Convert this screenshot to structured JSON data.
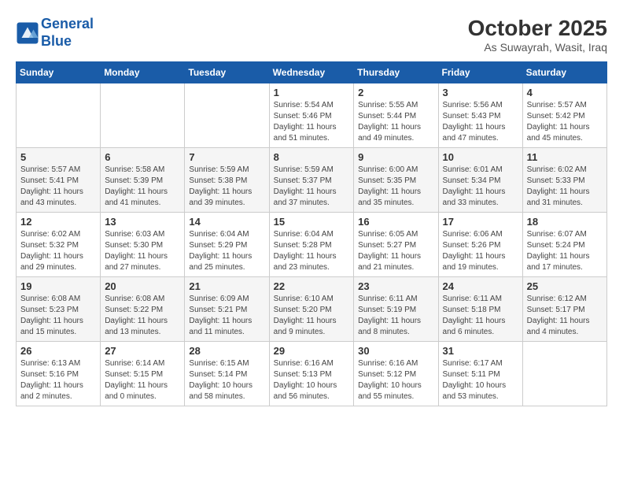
{
  "logo": {
    "line1": "General",
    "line2": "Blue"
  },
  "title": "October 2025",
  "location": "As Suwayrah, Wasit, Iraq",
  "days_of_week": [
    "Sunday",
    "Monday",
    "Tuesday",
    "Wednesday",
    "Thursday",
    "Friday",
    "Saturday"
  ],
  "weeks": [
    [
      {
        "day": "",
        "info": ""
      },
      {
        "day": "",
        "info": ""
      },
      {
        "day": "",
        "info": ""
      },
      {
        "day": "1",
        "info": "Sunrise: 5:54 AM\nSunset: 5:46 PM\nDaylight: 11 hours\nand 51 minutes."
      },
      {
        "day": "2",
        "info": "Sunrise: 5:55 AM\nSunset: 5:44 PM\nDaylight: 11 hours\nand 49 minutes."
      },
      {
        "day": "3",
        "info": "Sunrise: 5:56 AM\nSunset: 5:43 PM\nDaylight: 11 hours\nand 47 minutes."
      },
      {
        "day": "4",
        "info": "Sunrise: 5:57 AM\nSunset: 5:42 PM\nDaylight: 11 hours\nand 45 minutes."
      }
    ],
    [
      {
        "day": "5",
        "info": "Sunrise: 5:57 AM\nSunset: 5:41 PM\nDaylight: 11 hours\nand 43 minutes."
      },
      {
        "day": "6",
        "info": "Sunrise: 5:58 AM\nSunset: 5:39 PM\nDaylight: 11 hours\nand 41 minutes."
      },
      {
        "day": "7",
        "info": "Sunrise: 5:59 AM\nSunset: 5:38 PM\nDaylight: 11 hours\nand 39 minutes."
      },
      {
        "day": "8",
        "info": "Sunrise: 5:59 AM\nSunset: 5:37 PM\nDaylight: 11 hours\nand 37 minutes."
      },
      {
        "day": "9",
        "info": "Sunrise: 6:00 AM\nSunset: 5:35 PM\nDaylight: 11 hours\nand 35 minutes."
      },
      {
        "day": "10",
        "info": "Sunrise: 6:01 AM\nSunset: 5:34 PM\nDaylight: 11 hours\nand 33 minutes."
      },
      {
        "day": "11",
        "info": "Sunrise: 6:02 AM\nSunset: 5:33 PM\nDaylight: 11 hours\nand 31 minutes."
      }
    ],
    [
      {
        "day": "12",
        "info": "Sunrise: 6:02 AM\nSunset: 5:32 PM\nDaylight: 11 hours\nand 29 minutes."
      },
      {
        "day": "13",
        "info": "Sunrise: 6:03 AM\nSunset: 5:30 PM\nDaylight: 11 hours\nand 27 minutes."
      },
      {
        "day": "14",
        "info": "Sunrise: 6:04 AM\nSunset: 5:29 PM\nDaylight: 11 hours\nand 25 minutes."
      },
      {
        "day": "15",
        "info": "Sunrise: 6:04 AM\nSunset: 5:28 PM\nDaylight: 11 hours\nand 23 minutes."
      },
      {
        "day": "16",
        "info": "Sunrise: 6:05 AM\nSunset: 5:27 PM\nDaylight: 11 hours\nand 21 minutes."
      },
      {
        "day": "17",
        "info": "Sunrise: 6:06 AM\nSunset: 5:26 PM\nDaylight: 11 hours\nand 19 minutes."
      },
      {
        "day": "18",
        "info": "Sunrise: 6:07 AM\nSunset: 5:24 PM\nDaylight: 11 hours\nand 17 minutes."
      }
    ],
    [
      {
        "day": "19",
        "info": "Sunrise: 6:08 AM\nSunset: 5:23 PM\nDaylight: 11 hours\nand 15 minutes."
      },
      {
        "day": "20",
        "info": "Sunrise: 6:08 AM\nSunset: 5:22 PM\nDaylight: 11 hours\nand 13 minutes."
      },
      {
        "day": "21",
        "info": "Sunrise: 6:09 AM\nSunset: 5:21 PM\nDaylight: 11 hours\nand 11 minutes."
      },
      {
        "day": "22",
        "info": "Sunrise: 6:10 AM\nSunset: 5:20 PM\nDaylight: 11 hours\nand 9 minutes."
      },
      {
        "day": "23",
        "info": "Sunrise: 6:11 AM\nSunset: 5:19 PM\nDaylight: 11 hours\nand 8 minutes."
      },
      {
        "day": "24",
        "info": "Sunrise: 6:11 AM\nSunset: 5:18 PM\nDaylight: 11 hours\nand 6 minutes."
      },
      {
        "day": "25",
        "info": "Sunrise: 6:12 AM\nSunset: 5:17 PM\nDaylight: 11 hours\nand 4 minutes."
      }
    ],
    [
      {
        "day": "26",
        "info": "Sunrise: 6:13 AM\nSunset: 5:16 PM\nDaylight: 11 hours\nand 2 minutes."
      },
      {
        "day": "27",
        "info": "Sunrise: 6:14 AM\nSunset: 5:15 PM\nDaylight: 11 hours\nand 0 minutes."
      },
      {
        "day": "28",
        "info": "Sunrise: 6:15 AM\nSunset: 5:14 PM\nDaylight: 10 hours\nand 58 minutes."
      },
      {
        "day": "29",
        "info": "Sunrise: 6:16 AM\nSunset: 5:13 PM\nDaylight: 10 hours\nand 56 minutes."
      },
      {
        "day": "30",
        "info": "Sunrise: 6:16 AM\nSunset: 5:12 PM\nDaylight: 10 hours\nand 55 minutes."
      },
      {
        "day": "31",
        "info": "Sunrise: 6:17 AM\nSunset: 5:11 PM\nDaylight: 10 hours\nand 53 minutes."
      },
      {
        "day": "",
        "info": ""
      }
    ]
  ]
}
